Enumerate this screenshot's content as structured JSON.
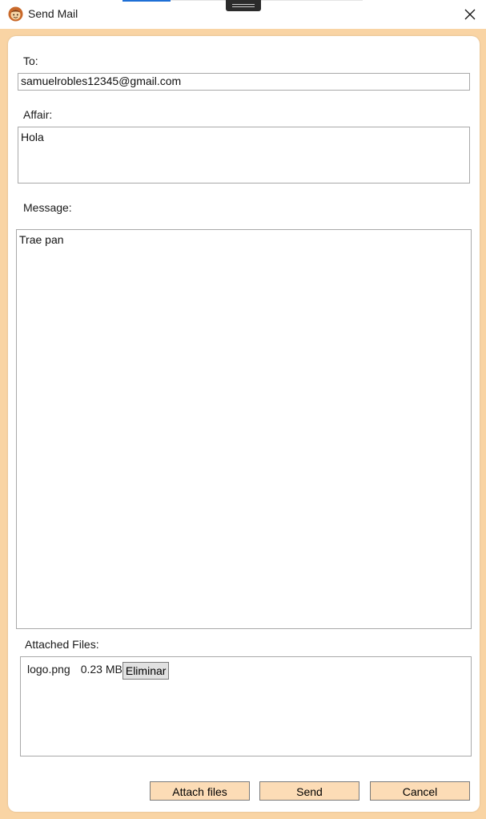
{
  "window": {
    "title": "Send Mail",
    "icon": "bread-mascot-icon",
    "accent_color": "#f9d4a4",
    "button_color": "#fcdcb6"
  },
  "form": {
    "to_label": "To:",
    "to_value": "samuelrobles12345@gmail.com",
    "affair_label": "Affair:",
    "affair_value": "Hola",
    "message_label": "Message:",
    "message_value": "Trae pan",
    "attached_label": "Attached Files:"
  },
  "attachments": [
    {
      "name": "logo.png",
      "size": "0.23 MB",
      "remove_label": "Eliminar"
    }
  ],
  "actions": {
    "attach_label": "Attach files",
    "send_label": "Send",
    "cancel_label": "Cancel"
  }
}
